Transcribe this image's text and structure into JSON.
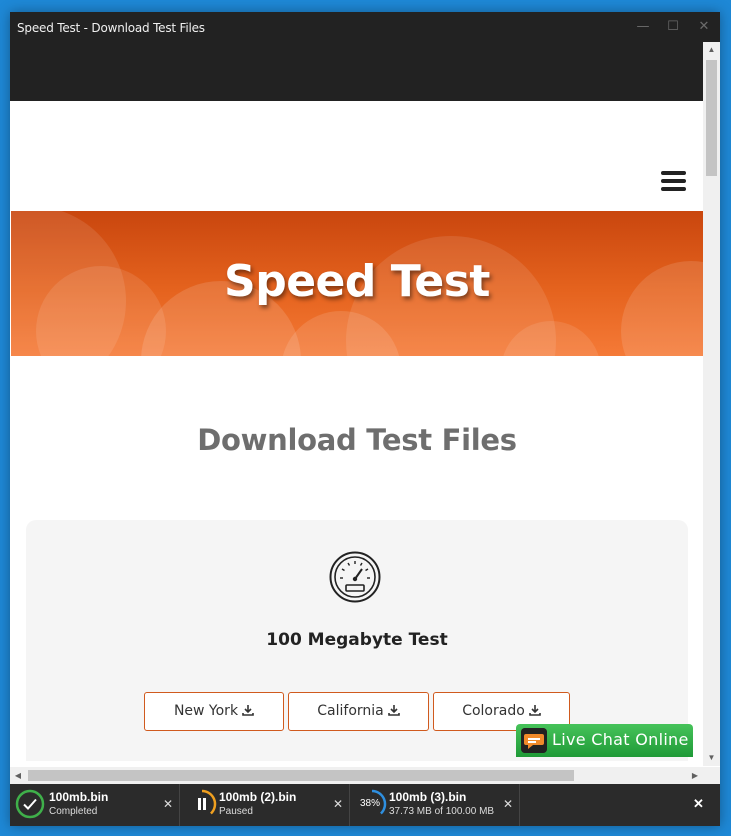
{
  "window": {
    "title": "Speed Test - Download Test Files",
    "minimize_glyph": "—",
    "maximize_glyph": "☐",
    "close_glyph": "✕"
  },
  "hero": {
    "title": "Speed Test"
  },
  "section": {
    "title": "Download Test Files"
  },
  "card": {
    "icon": "speedometer-icon",
    "title": "100 Megabyte Test",
    "buttons": [
      {
        "label": "New York",
        "icon": "download-icon"
      },
      {
        "label": "California",
        "icon": "download-icon"
      },
      {
        "label": "Colorado",
        "icon": "download-icon"
      }
    ]
  },
  "live_chat": {
    "label": "Live Chat Online",
    "icon": "chat-bubble-icon"
  },
  "downloads": [
    {
      "name": "100mb.bin",
      "status": "Completed",
      "state": "completed",
      "progress": 1.0
    },
    {
      "name": "100mb (2).bin",
      "status": "Paused",
      "state": "paused",
      "progress": 0.38
    },
    {
      "name": "100mb (3).bin",
      "status": "37.73 MB of 100.00 MB",
      "state": "downloading",
      "progress": 0.38,
      "percent_label": "38%"
    }
  ],
  "downloads_bar": {
    "close_glyph": "✕",
    "item_close_glyph": "✕"
  },
  "scrollbar": {
    "up": "▲",
    "down": "▼",
    "left": "◀",
    "right": "▶"
  },
  "colors": {
    "accent_orange": "#d05a1e",
    "live_chat_green": "#2aa843",
    "completed_green": "#3fb04a",
    "paused_amber": "#f0a020",
    "progress_blue": "#2e8fe0"
  }
}
